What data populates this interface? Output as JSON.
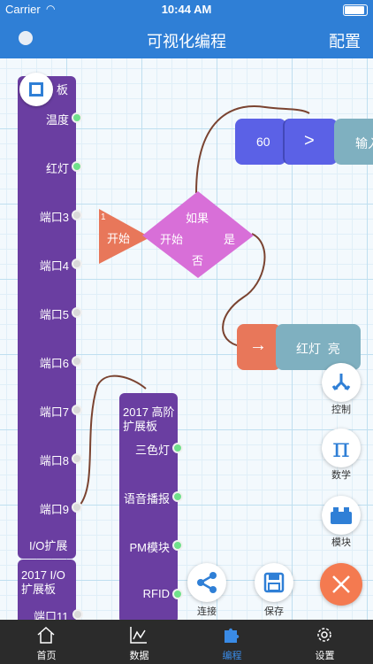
{
  "status": {
    "carrier": "Carrier",
    "time": "10:44 AM"
  },
  "header": {
    "title": "可视化编程",
    "config": "配置"
  },
  "board1": {
    "title_fragment": "板",
    "ports": [
      "温度",
      "红灯",
      "端口3",
      "端口4",
      "端口5",
      "端口6",
      "端口7",
      "端口8",
      "端口9"
    ],
    "footer": "I/O扩展"
  },
  "board2": {
    "title": "2017 I/O\n扩展板",
    "port": "端口11"
  },
  "board3": {
    "title": "2017 高阶\n扩展板",
    "ports": [
      "三色灯",
      "语音播报",
      "PM模块",
      "RFID"
    ]
  },
  "blocks": {
    "start_number": "1",
    "start_label": "开始",
    "if_label": "如果",
    "if_start": "开始",
    "if_yes": "是",
    "if_no": "否",
    "value_60": "60",
    "compare_op": ">",
    "input_fragment": "输入",
    "arrow": "→",
    "action": "红灯  亮"
  },
  "side_buttons": {
    "control": "控制",
    "math": "数学",
    "math_symbol": "π",
    "module": "模块"
  },
  "bottom_buttons": {
    "connect": "连接",
    "save": "保存"
  },
  "tabs": [
    "首页",
    "数据",
    "编程",
    "设置"
  ],
  "colors": {
    "accent": "#2f7fd6",
    "purple": "#6a3ea1",
    "orange": "#e8775a",
    "teal": "#7fb0c0",
    "blue_block": "#5b61e6",
    "pink": "#d86fd8"
  }
}
